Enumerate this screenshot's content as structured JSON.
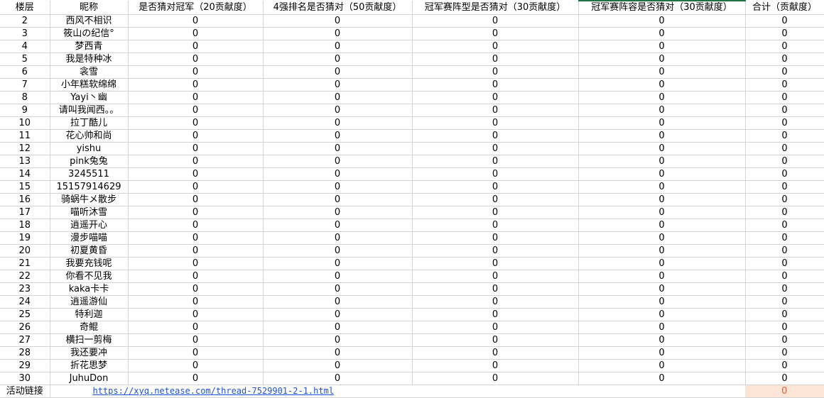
{
  "headers": [
    "楼层",
    "昵称",
    "是否猜对冠军（20贡献度）",
    "4强排名是否猜对（50贡献度）",
    "冠军赛阵型是否猜对（30贡献度）",
    "冠军赛阵容是否猜对（30贡献度）",
    "合计（贡献度）"
  ],
  "rows": [
    [
      "2",
      "西风不相识",
      "0",
      "0",
      "0",
      "0",
      "0"
    ],
    [
      "3",
      "筱山の纪信°",
      "0",
      "0",
      "0",
      "0",
      "0"
    ],
    [
      "4",
      "梦西青",
      "0",
      "0",
      "0",
      "0",
      "0"
    ],
    [
      "5",
      "我是特种冰",
      "0",
      "0",
      "0",
      "0",
      "0"
    ],
    [
      "6",
      "衾雪",
      "0",
      "0",
      "0",
      "0",
      "0"
    ],
    [
      "7",
      "小年糕软绵绵",
      "0",
      "0",
      "0",
      "0",
      "0"
    ],
    [
      "8",
      "Yayi丶幽",
      "0",
      "0",
      "0",
      "0",
      "0"
    ],
    [
      "9",
      "请叫我闻西。。",
      "0",
      "0",
      "0",
      "0",
      "0"
    ],
    [
      "10",
      "拉丁酷儿",
      "0",
      "0",
      "0",
      "0",
      "0"
    ],
    [
      "11",
      "花心帅和尚",
      "0",
      "0",
      "0",
      "0",
      "0"
    ],
    [
      "12",
      "yishu",
      "0",
      "0",
      "0",
      "0",
      "0"
    ],
    [
      "13",
      "pink兔兔",
      "0",
      "0",
      "0",
      "0",
      "0"
    ],
    [
      "14",
      "3245511",
      "0",
      "0",
      "0",
      "0",
      "0"
    ],
    [
      "15",
      "15157914629",
      "0",
      "0",
      "0",
      "0",
      "0"
    ],
    [
      "16",
      "骑蜗牛メ散步",
      "0",
      "0",
      "0",
      "0",
      "0"
    ],
    [
      "17",
      "喵听沐雪",
      "0",
      "0",
      "0",
      "0",
      "0"
    ],
    [
      "18",
      "逍遥开心",
      "0",
      "0",
      "0",
      "0",
      "0"
    ],
    [
      "19",
      "漫步喵喵",
      "0",
      "0",
      "0",
      "0",
      "0"
    ],
    [
      "20",
      "初夏黄昏",
      "0",
      "0",
      "0",
      "0",
      "0"
    ],
    [
      "21",
      "我要充钱呢",
      "0",
      "0",
      "0",
      "0",
      "0"
    ],
    [
      "22",
      "你看不见我",
      "0",
      "0",
      "0",
      "0",
      "0"
    ],
    [
      "23",
      "kaka卡卡",
      "0",
      "0",
      "0",
      "0",
      "0"
    ],
    [
      "24",
      "逍遥游仙",
      "0",
      "0",
      "0",
      "0",
      "0"
    ],
    [
      "25",
      "特利迦",
      "0",
      "0",
      "0",
      "0",
      "0"
    ],
    [
      "26",
      "奇鲲",
      "0",
      "0",
      "0",
      "0",
      "0"
    ],
    [
      "27",
      "横扫一剪梅",
      "0",
      "0",
      "0",
      "0",
      "0"
    ],
    [
      "28",
      "我还要冲",
      "0",
      "0",
      "0",
      "0",
      "0"
    ],
    [
      "29",
      "折花思梦",
      "0",
      "0",
      "0",
      "0",
      "0"
    ],
    [
      "30",
      "JuhuDon",
      "0",
      "0",
      "0",
      "0",
      "0"
    ]
  ],
  "footer": {
    "label": "活动链接",
    "link": "https://xyq.netease.com/thread-7529901-2-1.html",
    "total": "0"
  },
  "colors": {
    "grid": "#d4d4d4",
    "link": "#1f4fd6",
    "highlight_bg": "#fce4d6",
    "highlight_text": "#e05f3a",
    "selection": "#217346"
  }
}
